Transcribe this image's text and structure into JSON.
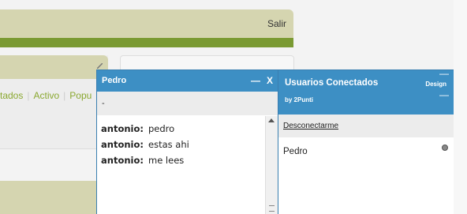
{
  "header": {
    "logout_label": "Salir"
  },
  "tabs": [
    "tados",
    "Activo",
    "Popu"
  ],
  "chat": {
    "title": "Pedro",
    "min_glyph": "—",
    "close_glyph": "X",
    "status": "-",
    "messages": [
      {
        "from": "antonio:",
        "text": "pedro"
      },
      {
        "from": "antonio:",
        "text": "estas ahi"
      },
      {
        "from": "antonio:",
        "text": "me lees"
      }
    ]
  },
  "users": {
    "title": "Usuarios Conectados",
    "subtitle": "by 2Punti",
    "design_label": "Design",
    "min_glyph": "—",
    "disconnect_label": "Desconectarme",
    "list": [
      {
        "name": "Pedro",
        "status": "offline"
      }
    ]
  },
  "colors": {
    "window_blue": "#3d8fc4",
    "header_khaki": "#d5d5b0",
    "stripe_green": "#7a9a32",
    "link_green": "#8aa830"
  },
  "icons": [
    "pencil-icon",
    "minimize-icon",
    "close-icon",
    "scroll-up-icon",
    "status-dot-icon"
  ]
}
